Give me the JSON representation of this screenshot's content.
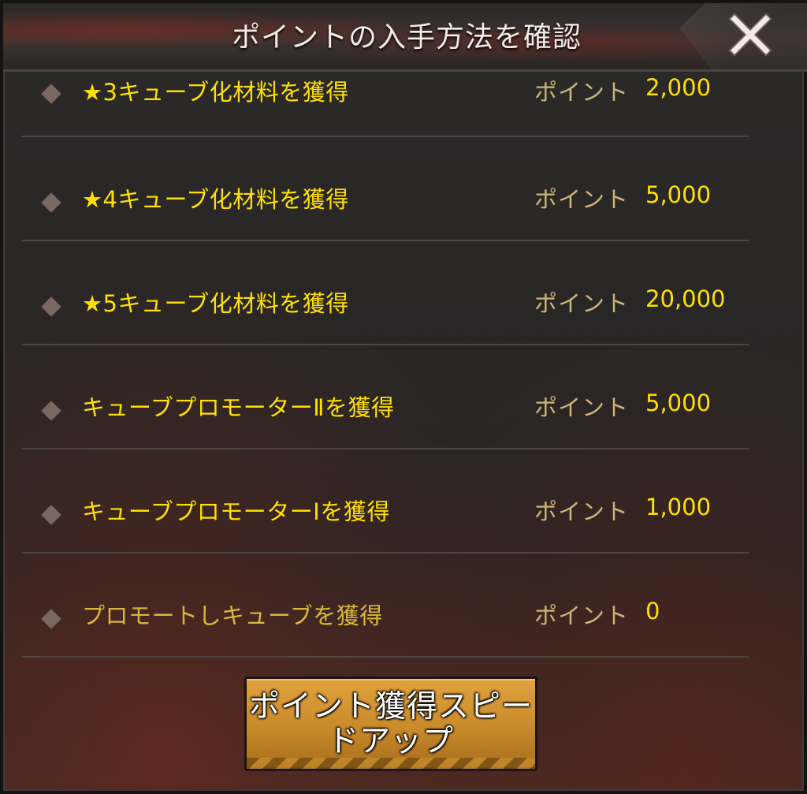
{
  "dialog": {
    "title": "ポイントの入手方法を確認",
    "close_icon": "close-x-icon"
  },
  "rows": [
    {
      "label": "★3キューブ化材料を獲得",
      "points_label": "ポイント",
      "points": "2,000"
    },
    {
      "label": "★4キューブ化材料を獲得",
      "points_label": "ポイント",
      "points": "5,000"
    },
    {
      "label": "★5キューブ化材料を獲得",
      "points_label": "ポイント",
      "points": "20,000"
    },
    {
      "label": "キューブプロモーターⅡを獲得",
      "points_label": "ポイント",
      "points": "5,000"
    },
    {
      "label": "キューブプロモーターⅠを獲得",
      "points_label": "ポイント",
      "points": "1,000"
    },
    {
      "label": "プロモートしキューブを獲得",
      "points_label": "ポイント",
      "points": "0"
    }
  ],
  "footer": {
    "speed_button_label": "ポイント獲得スピードアップ"
  },
  "colors": {
    "accent_yellow": "#ffe000",
    "muted_gold": "#cdb478",
    "button_orange": "#c88a2a"
  }
}
